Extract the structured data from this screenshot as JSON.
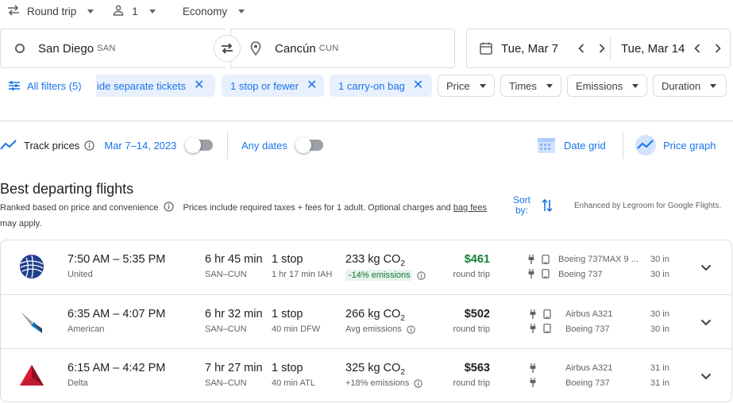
{
  "top": {
    "trip_type": "Round trip",
    "passengers": "1",
    "cabin": "Economy"
  },
  "search": {
    "origin": {
      "name": "San Diego",
      "code": "SAN"
    },
    "destination": {
      "name": "Cancún",
      "code": "CUN"
    },
    "depart_date": "Tue, Mar 7",
    "return_date": "Tue, Mar 14"
  },
  "filters": {
    "all_filters": "All filters (5)",
    "active": [
      {
        "label": "ide separate tickets"
      },
      {
        "label": "1 stop or fewer"
      },
      {
        "label": "1 carry-on bag"
      }
    ],
    "dropdowns": [
      "Price",
      "Times",
      "Emissions",
      "Duration"
    ]
  },
  "track": {
    "label": "Track prices",
    "date_range": "Mar 7–14, 2023",
    "any_dates": "Any dates",
    "date_grid": "Date grid",
    "price_graph": "Price graph"
  },
  "results": {
    "heading": "Best departing flights",
    "subtitle_part1": "Ranked based on price and convenience",
    "subtitle_part2": "Prices include required taxes + fees for 1 adult. Optional charges and",
    "bag_fees": "bag fees",
    "subtitle_part3": "may apply.",
    "sort_line1": "Sort",
    "sort_line2": "by:",
    "enhanced": "Enhanced by Legroom for Google Flights."
  },
  "flights": [
    {
      "times": "7:50 AM – 5:35 PM",
      "airline": "United",
      "duration": "6 hr 45 min",
      "route": "SAN–CUN",
      "stops": "1 stop",
      "stop_info": "1 hr 17 min IAH",
      "co2_value": "233 kg CO",
      "co2_sub": "2",
      "emissions": "-14% emissions",
      "price": "$461",
      "price_type": "round trip",
      "aircraft": [
        "Boeing 737MAX 9 ...",
        "Boeing 737"
      ],
      "legroom": [
        "30 in",
        "30 in"
      ]
    },
    {
      "times": "6:35 AM – 4:07 PM",
      "airline": "American",
      "duration": "6 hr 32 min",
      "route": "SAN–CUN",
      "stops": "1 stop",
      "stop_info": "40 min DFW",
      "co2_value": "266 kg CO",
      "co2_sub": "2",
      "emissions": "Avg emissions",
      "price": "$502",
      "price_type": "round trip",
      "aircraft": [
        "Airbus A321",
        "Boeing 737"
      ],
      "legroom": [
        "30 in",
        "30 in"
      ]
    },
    {
      "times": "6:15 AM – 4:42 PM",
      "airline": "Delta",
      "duration": "7 hr 27 min",
      "route": "SAN–CUN",
      "stops": "1 stop",
      "stop_info": "40 min ATL",
      "co2_value": "325 kg CO",
      "co2_sub": "2",
      "emissions": "+18% emissions",
      "price": "$563",
      "price_type": "round trip",
      "aircraft": [
        "Airbus A321",
        "Boeing 737"
      ],
      "legroom": [
        "31 in",
        "31 in"
      ]
    }
  ],
  "colors": {
    "accent": "#1a73e8",
    "low_price": "#188038",
    "chip_active_bg": "#e8f0fe",
    "border": "#dadce0"
  }
}
